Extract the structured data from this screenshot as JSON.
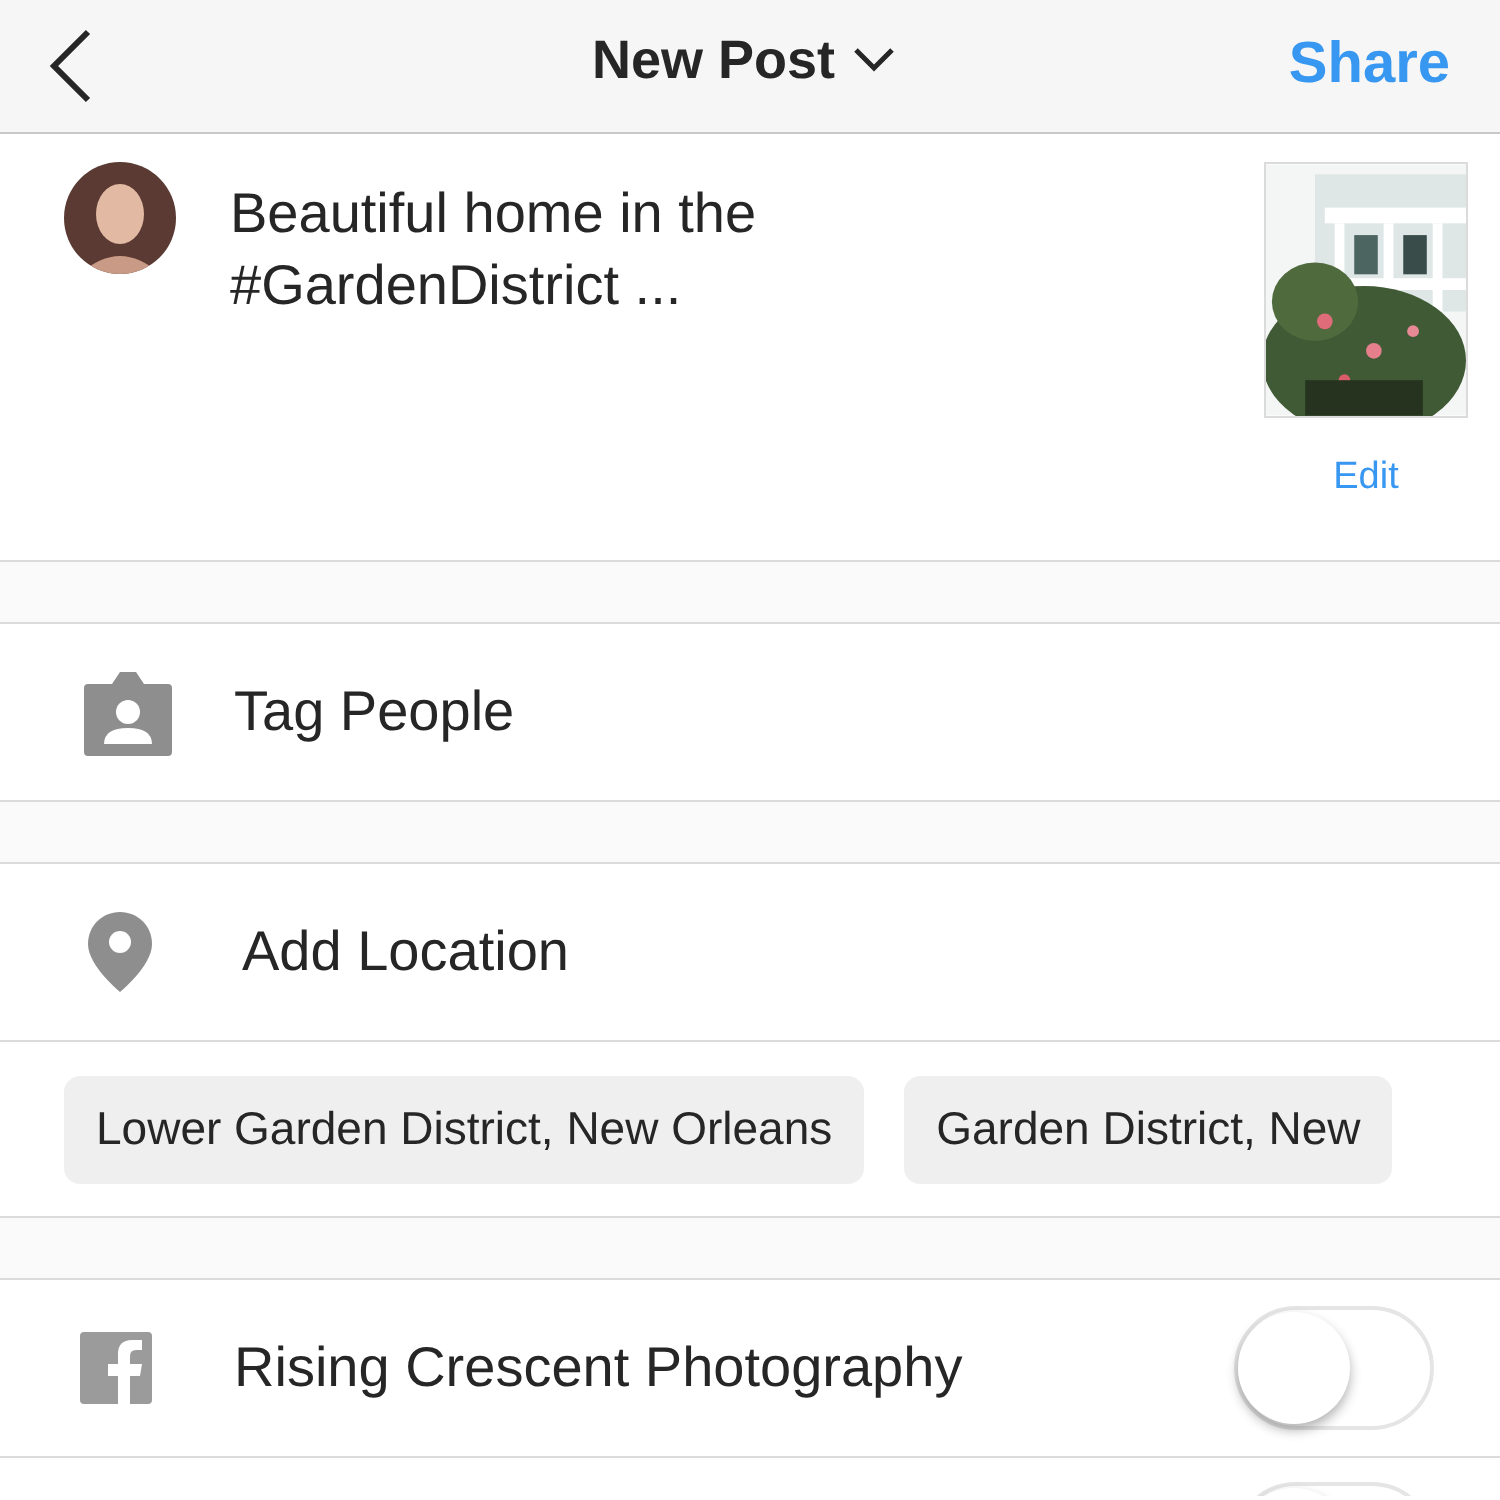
{
  "header": {
    "title": "New Post",
    "action": "Share"
  },
  "caption": {
    "text": "Beautiful home in the #GardenDistrict ...",
    "edit_label": "Edit"
  },
  "options": [
    {
      "kind": "tag",
      "label": "Tag People"
    },
    {
      "kind": "location",
      "label": "Add Location"
    }
  ],
  "location_suggestions": [
    "Lower Garden District, New Orleans",
    "Garden District, New"
  ],
  "share_targets": [
    {
      "kind": "facebook",
      "label": "Rising Crescent Photography",
      "on": false
    },
    {
      "kind": "partial",
      "on": false
    }
  ]
}
